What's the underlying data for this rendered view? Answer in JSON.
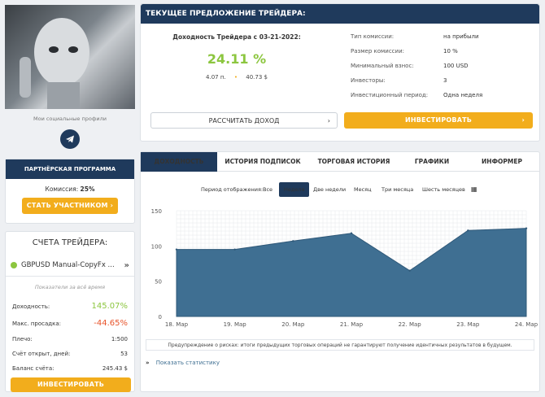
{
  "profile": {
    "social_label": "Мои социальные профили",
    "telegram_icon": "telegram-icon"
  },
  "partner": {
    "title": "ПАРТНЁРСКАЯ ПРОГРАММА",
    "commission_label": "Комиссия:",
    "commission_value": "25%",
    "join_button": "СТАТЬ УЧАСТНИКОМ ›"
  },
  "accounts": {
    "title": "СЧЕТА ТРЕЙДЕРА:",
    "selected": "GBPUSD Manual-CopyFx ...",
    "subtitle": "Показатели за всё время",
    "rows": [
      {
        "label": "Доходность:",
        "value": "145.07%"
      },
      {
        "label": "Макс. просадка:",
        "value": "-44.65%"
      },
      {
        "label": "Плечо:",
        "value": "1:500"
      },
      {
        "label": "Счёт открыт, дней:",
        "value": "53"
      },
      {
        "label": "Баланс счёта:",
        "value": "245.43 $"
      }
    ],
    "invest_button": "ИНВЕСТИРОВАТЬ"
  },
  "offer": {
    "title": "ТЕКУЩЕЕ ПРЕДЛОЖЕНИЕ ТРЕЙДЕРА:",
    "yield_label": "Доходность Трейдера с 03-21-2022:",
    "yield_value": "24.11 %",
    "points": "4.07 п.",
    "dollars": "40.73 $",
    "details": [
      {
        "label": "Тип комиссии:",
        "value": "на прибыли"
      },
      {
        "label": "Размер комиссии:",
        "value": "10 %"
      },
      {
        "label": "Минимальный взнос:",
        "value": "100 USD"
      },
      {
        "label": "Инвесторы:",
        "value": "3"
      },
      {
        "label": "Инвестиционный период:",
        "value": "Одна неделя"
      }
    ],
    "calc_button": "РАССЧИТАТЬ ДОХОД",
    "invest_button": "ИНВЕСТИРОВАТЬ"
  },
  "tabs": [
    "ДОХОДНОСТЬ",
    "ИСТОРИЯ ПОДПИСОК",
    "ТОРГОВАЯ ИСТОРИЯ",
    "ГРАФИКИ",
    "ИНФОРМЕР"
  ],
  "period": {
    "label": "Период отображения:",
    "options": [
      "Все",
      "Неделя",
      "Две недели",
      "Месяц",
      "Три месяца",
      "Шесть месяцев"
    ],
    "active": "Неделя"
  },
  "chart_data": {
    "type": "area",
    "x": [
      "18. Мар",
      "19. Мар",
      "20. Мар",
      "21. Мар",
      "22. Мар",
      "23. Мар",
      "24. Мар"
    ],
    "values": [
      95,
      95,
      107,
      118,
      65,
      122,
      125
    ],
    "ylim": [
      0,
      150
    ],
    "yticks": [
      0,
      50,
      100,
      150
    ],
    "color": "#3f6f92",
    "grid": true
  },
  "warning": "Предупреждение о рисках: итоги предыдущих торговых операций не гарантируют получение идентичных результатов в будущем.",
  "show_stats": "Показать статистику"
}
